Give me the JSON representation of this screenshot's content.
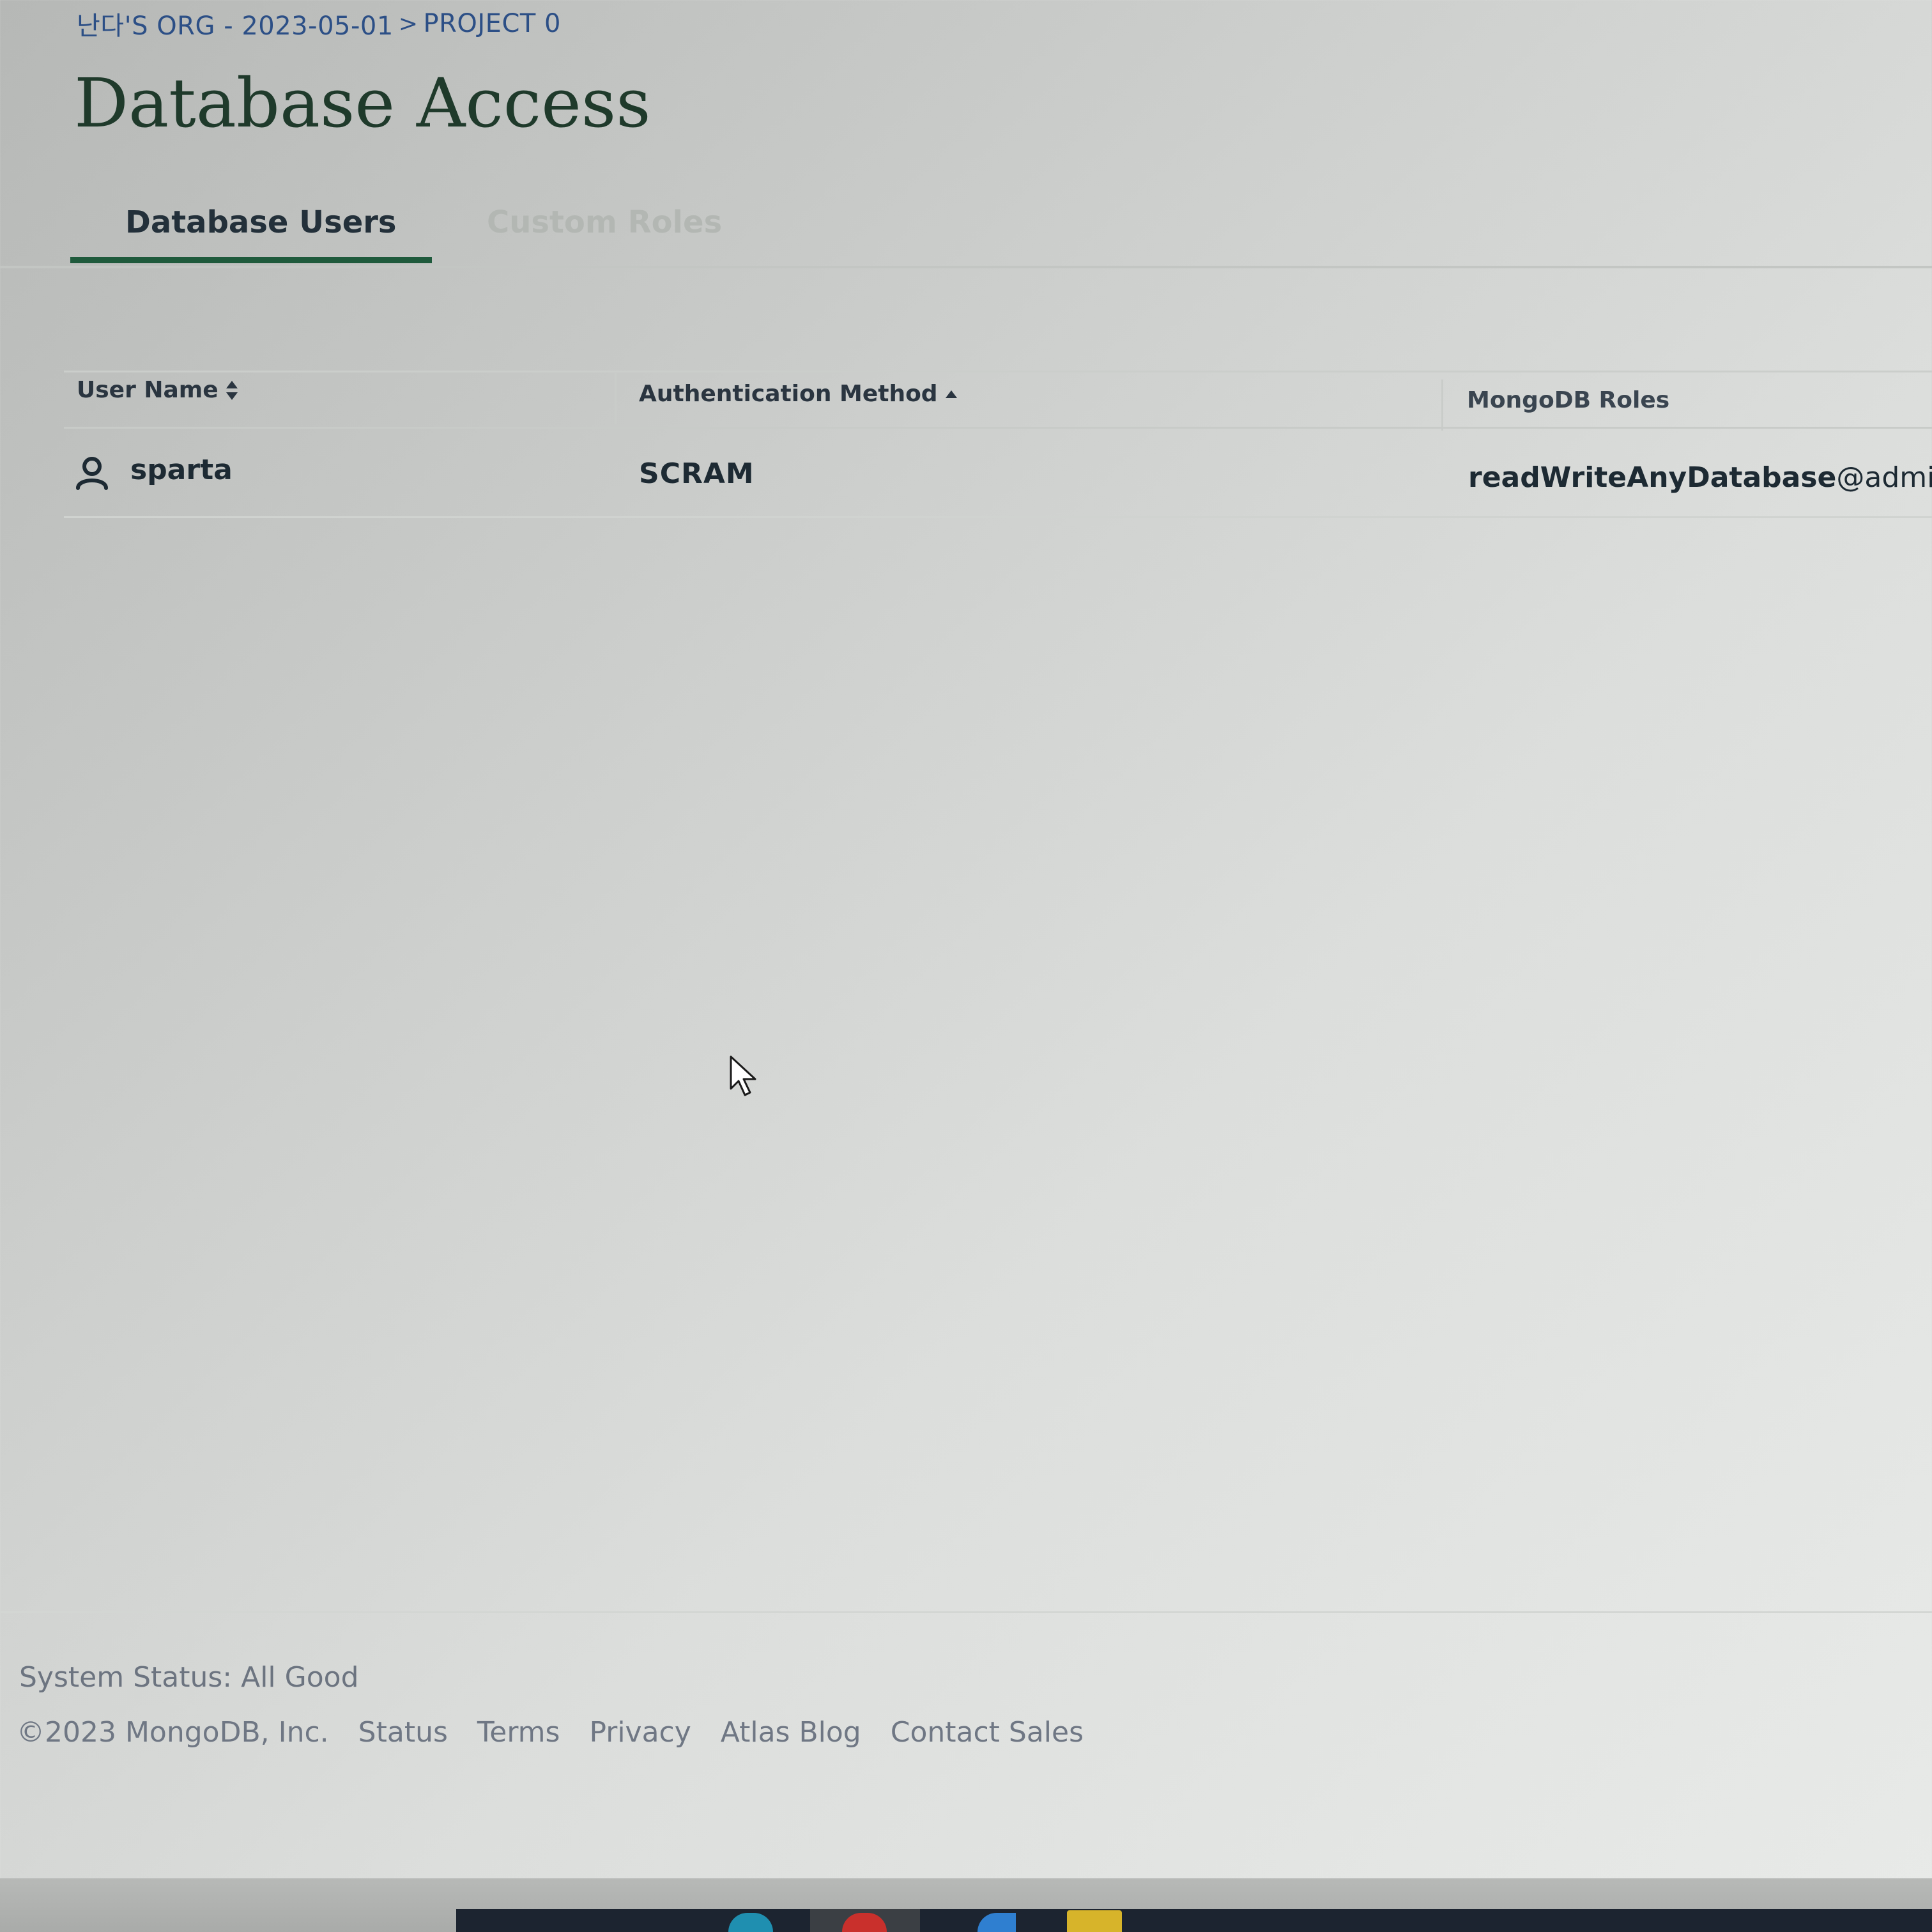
{
  "breadcrumb": {
    "org": "난다'S ORG - 2023-05-01",
    "separator": ">",
    "project": "PROJECT 0"
  },
  "page": {
    "title": "Database Access"
  },
  "tabs": [
    {
      "label": "Database Users",
      "active": true
    },
    {
      "label": "Custom Roles",
      "active": false
    }
  ],
  "table": {
    "columns": [
      {
        "label": "User Name",
        "sort_icon": "sort-both-icon"
      },
      {
        "label": "Authentication Method",
        "sort_icon": "sort-asc-icon"
      },
      {
        "label": "MongoDB Roles"
      }
    ],
    "rows": [
      {
        "icon": "user-icon",
        "user_name": "sparta",
        "auth_method": "SCRAM",
        "role_name": "readWriteAnyDatabase",
        "role_db": "@admin"
      }
    ]
  },
  "footer": {
    "status_label": "System Status:",
    "status_value": "All Good",
    "copyright": "©2023 MongoDB, Inc.",
    "links": [
      "Status",
      "Terms",
      "Privacy",
      "Atlas Blog",
      "Contact Sales"
    ]
  },
  "colors": {
    "accent_green": "#1f5a3c",
    "breadcrumb_blue": "#2c4f86",
    "title_green": "#1f3a2b"
  }
}
